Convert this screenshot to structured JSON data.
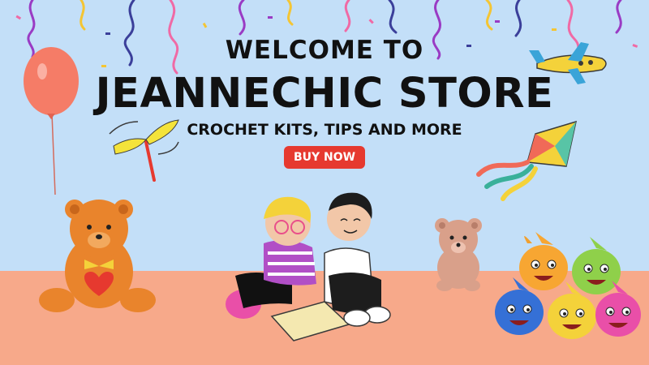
{
  "banner": {
    "heading_top": "WELCOME TO",
    "heading_main": "JEANNECHIC STORE",
    "subheading": "CROCHET KITS, TIPS AND MORE",
    "cta_label": "BUY NOW"
  },
  "colors": {
    "sky": "#c3dff8",
    "floor": "#f7a98a",
    "cta": "#e6392f",
    "text": "#111111"
  },
  "decor": [
    "confetti-streamers",
    "balloon-icon",
    "airplane-icon",
    "kite-icon",
    "propeller-toy-icon",
    "teddy-bear-icon",
    "kids-reading-illustration",
    "baby-shark-plush-icon"
  ]
}
